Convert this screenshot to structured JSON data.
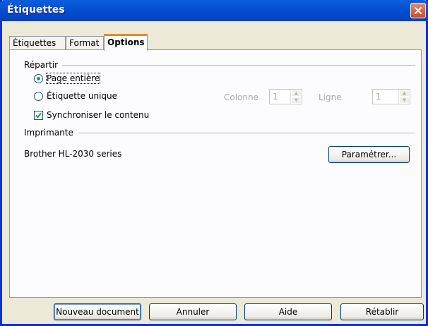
{
  "window": {
    "title": "Étiquettes"
  },
  "tabs": [
    {
      "label": "Étiquettes"
    },
    {
      "label": "Format"
    },
    {
      "label": "Options"
    }
  ],
  "distribute": {
    "heading": "Répartir",
    "full_page": "Page entière",
    "single_label": "Étiquette unique",
    "column_label": "Colonne",
    "column_value": "1",
    "row_label": "Ligne",
    "row_value": "1",
    "sync_contents": "Synchroniser le contenu"
  },
  "printer": {
    "heading": "Imprimante",
    "name": "Brother HL-2030 series",
    "setup_button": "Paramétrer..."
  },
  "footer": {
    "new_document": "Nouveau document",
    "cancel": "Annuler",
    "help": "Aide",
    "reset": "Rétablir"
  }
}
